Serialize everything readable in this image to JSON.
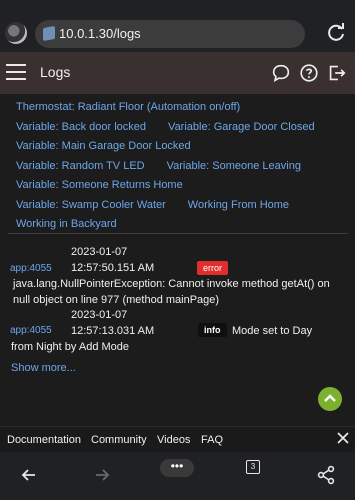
{
  "browser": {
    "url": "10.0.1.30/logs",
    "tab_count": "3",
    "menu_label": "•••"
  },
  "header": {
    "title": "Logs"
  },
  "filters": [
    "Thermostat: Radiant Floor (Automation on/off)",
    "Variable: Back door locked",
    "Variable: Garage Door Closed",
    "Variable: Main Garage Door Locked",
    "Variable: Random TV LED",
    "Variable: Someone Leaving",
    "Variable: Someone Returns Home",
    "Variable: Swamp Cooler Water",
    "Working From Home",
    "Working in Backyard"
  ],
  "logs": [
    {
      "source": "app:4055",
      "time": "2023-01-07 12:57:50.151 AM",
      "level": "error",
      "message": "java.lang.NullPointerException: Cannot invoke method getAt() on null object on line 977 (method mainPage)"
    },
    {
      "source": "app:4055",
      "time": "2023-01-07 12:57:13.031 AM",
      "level": "info",
      "message": "Mode set to Day from Night by Add Mode"
    }
  ],
  "show_more": "Show more...",
  "footer_links": [
    "Documentation",
    "Community",
    "Videos",
    "FAQ"
  ],
  "colors": {
    "link": "#6ea6ea",
    "header_bg": "#3a302f",
    "error_badge": "#e02e2e",
    "fab": "#7bb12e"
  }
}
